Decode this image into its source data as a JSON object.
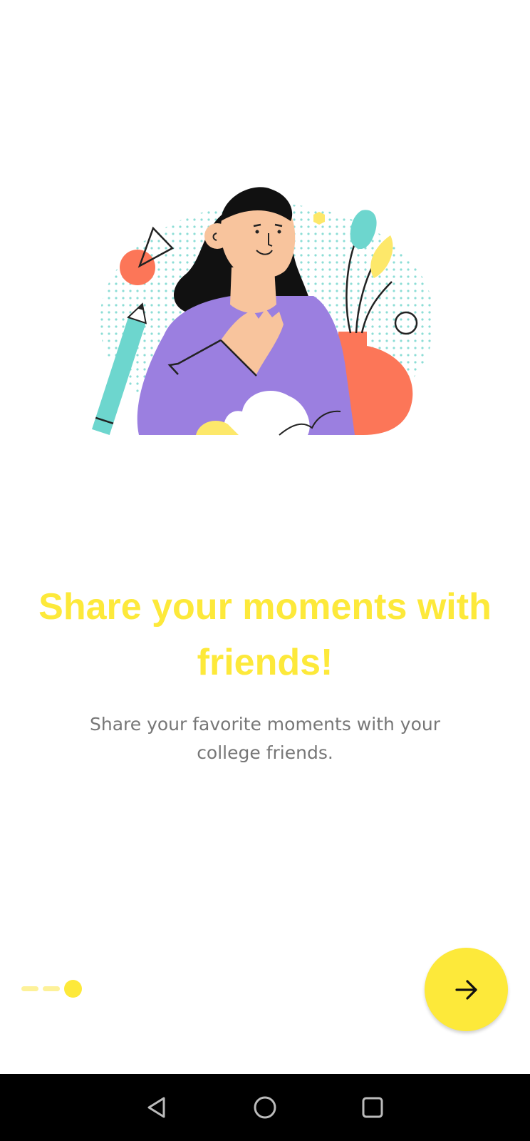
{
  "onboarding": {
    "title": "Share your moments with friends!",
    "subtitle": "Share your favorite moments with your college friends.",
    "illustration": "woman-hand-on-chest-illustration",
    "page_indicator": {
      "total_pages": 3,
      "current_page": 3
    },
    "next_button_icon": "arrow-right-icon"
  },
  "colors": {
    "accent": "#fde93a",
    "accent_light": "#fdf199",
    "subtitle_text": "#777777",
    "purple": "#9b7fe0",
    "coral": "#fc7658",
    "teal": "#6dd6ce",
    "skin": "#f8c49d"
  },
  "system_nav": {
    "back_icon": "triangle-back-icon",
    "home_icon": "circle-home-icon",
    "recents_icon": "square-recents-icon"
  }
}
